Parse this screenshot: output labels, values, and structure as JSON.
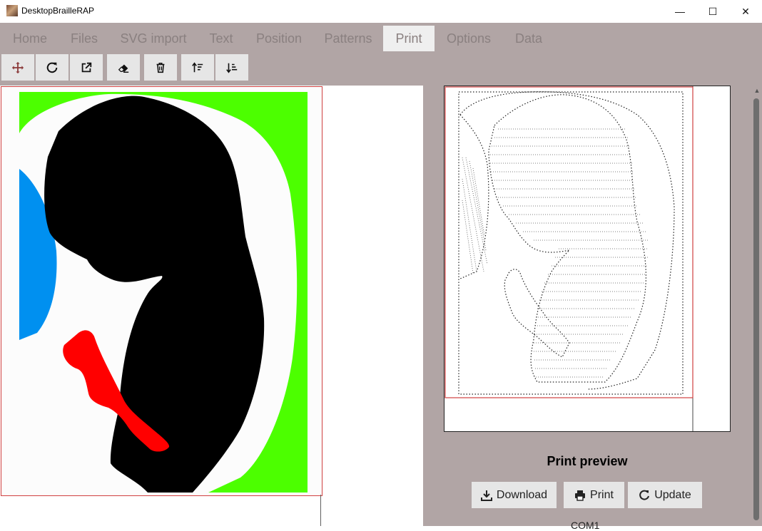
{
  "window": {
    "title": "DesktopBrailleRAP",
    "minimize": "—",
    "maximize": "☐",
    "close": "✕"
  },
  "tabs": [
    {
      "label": "Home"
    },
    {
      "label": "Files"
    },
    {
      "label": "SVG import"
    },
    {
      "label": "Text"
    },
    {
      "label": "Position"
    },
    {
      "label": "Patterns"
    },
    {
      "label": "Print",
      "active": true
    },
    {
      "label": "Options"
    },
    {
      "label": "Data"
    }
  ],
  "toolbar": {
    "icons": [
      "move-icon",
      "rotate-icon",
      "external-link-icon",
      "eraser-icon",
      "trash-icon",
      "sort-up-icon",
      "sort-down-icon"
    ]
  },
  "preview": {
    "label": "Print preview",
    "buttons": [
      {
        "label": "Download",
        "icon": "download-icon"
      },
      {
        "label": "Print",
        "icon": "printer-icon"
      },
      {
        "label": "Update",
        "icon": "refresh-icon"
      }
    ],
    "port": "COM1"
  },
  "colors": {
    "panel": "#b1a5a5",
    "active_tab": "#efefef",
    "green": "#4cff00",
    "blue": "#0090f0",
    "red": "#ff0000",
    "black": "#000000",
    "frame_red": "#d04040"
  }
}
